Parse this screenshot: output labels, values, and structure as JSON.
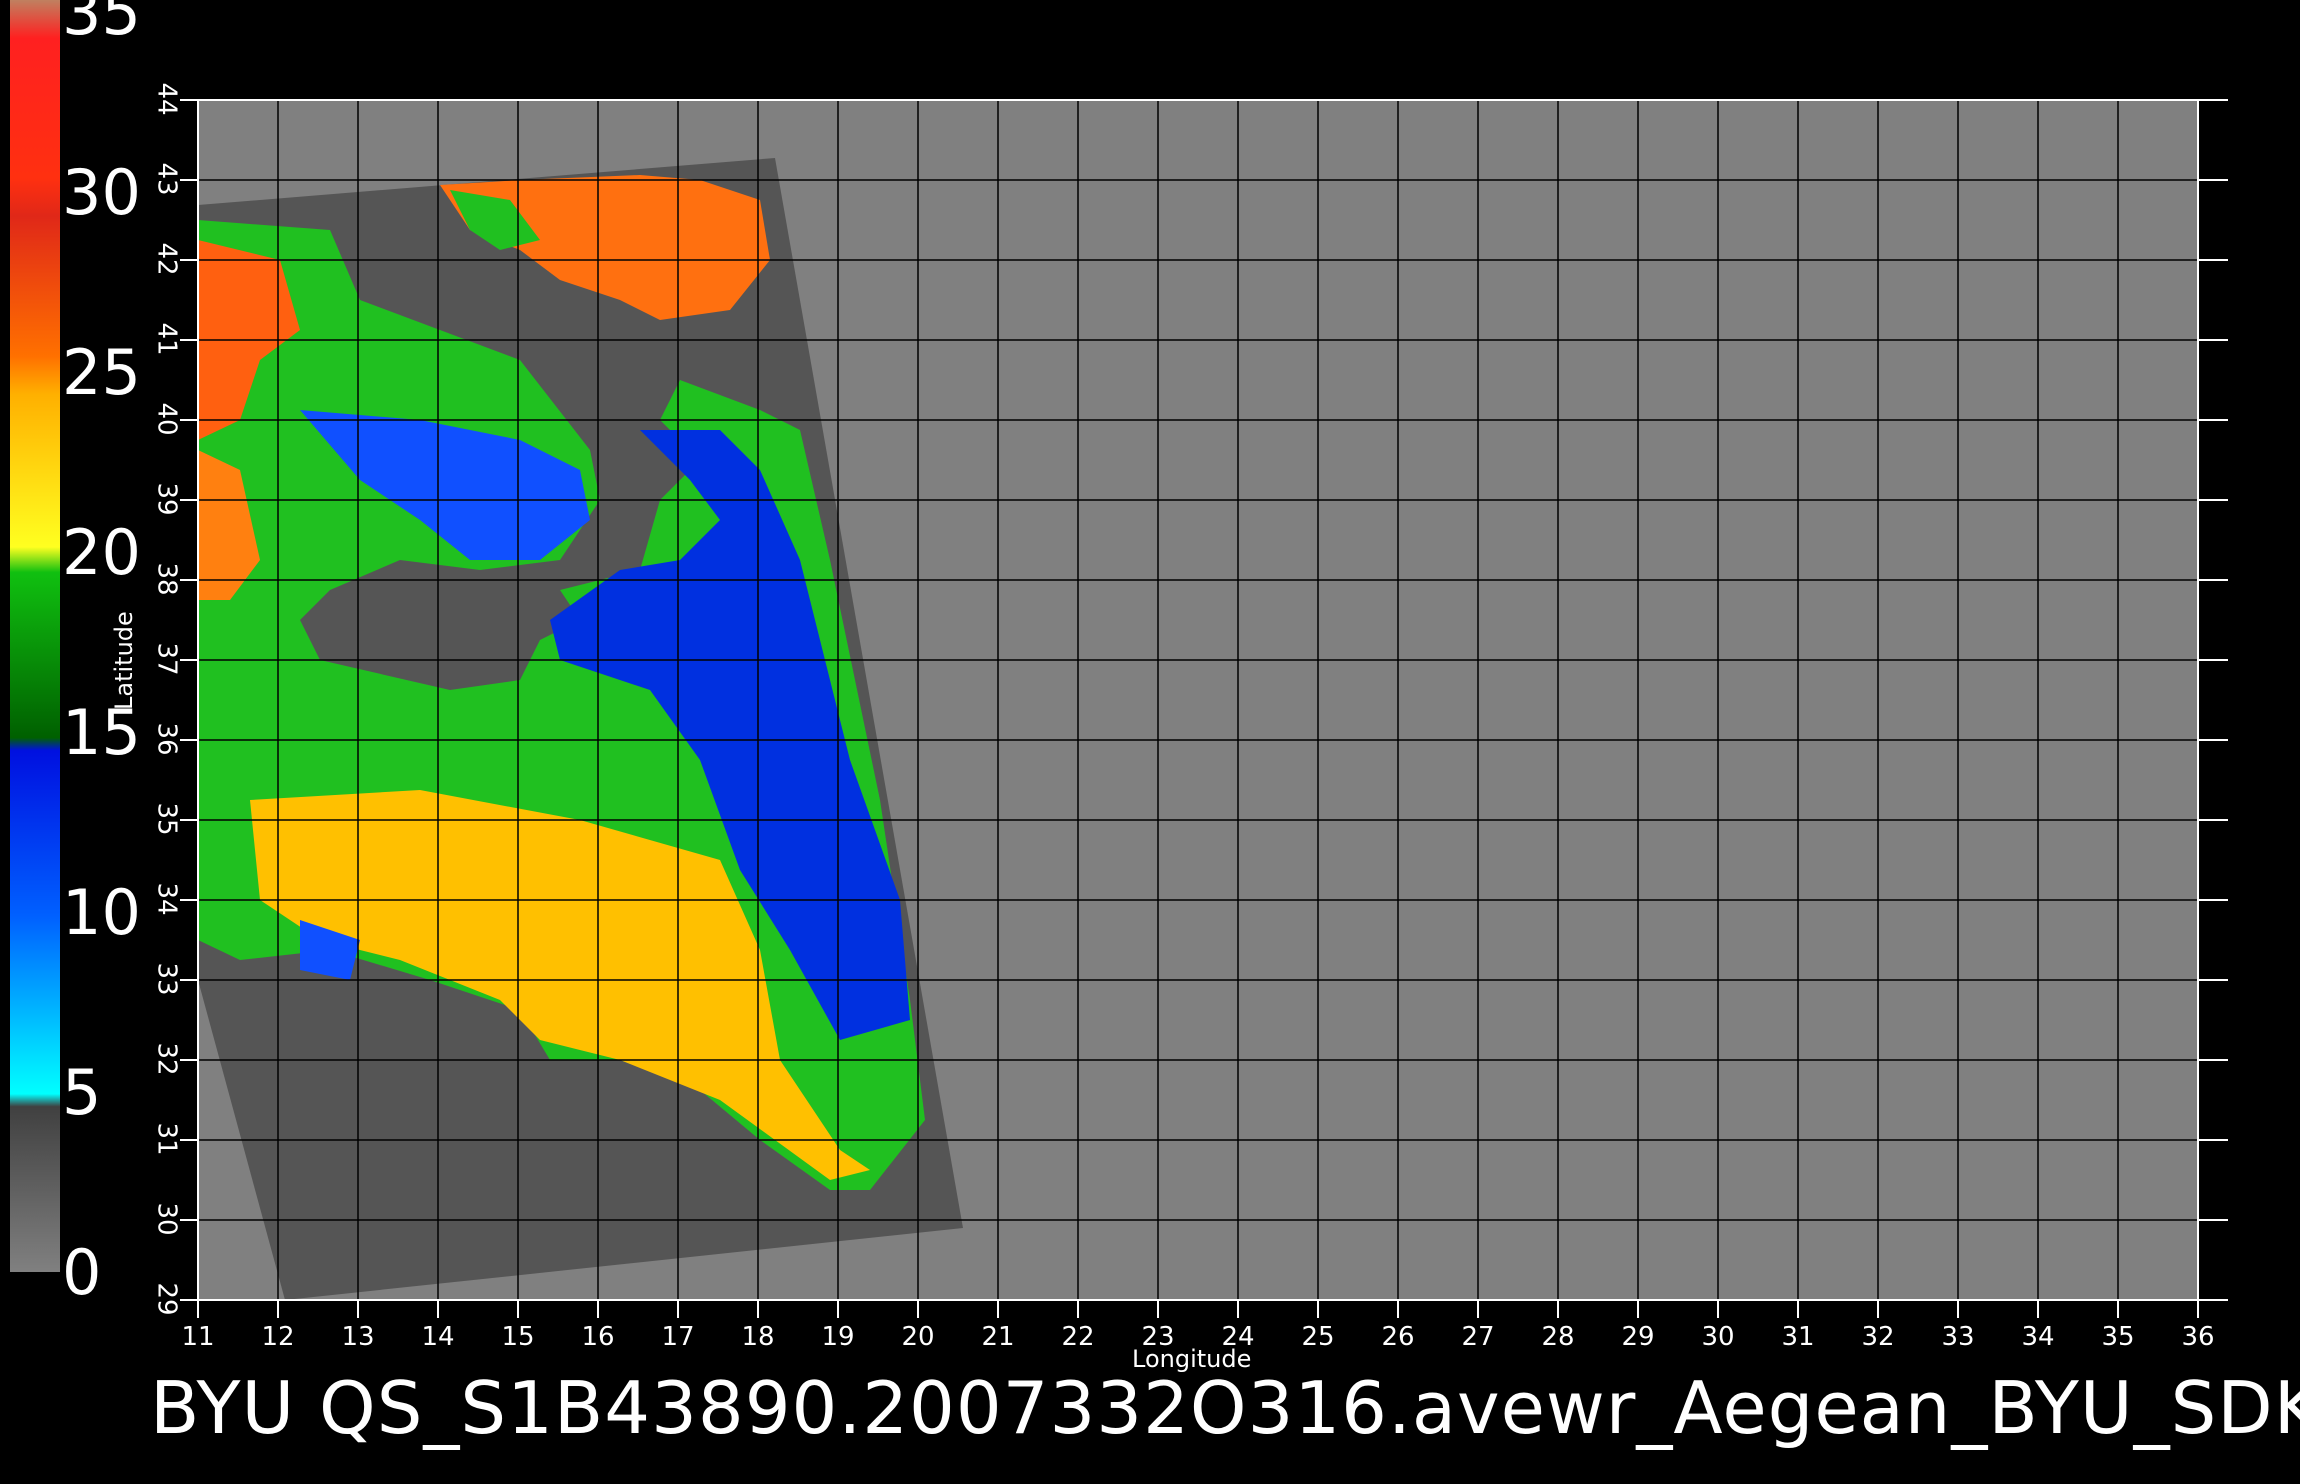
{
  "colorbar": {
    "labels": [
      "35",
      "30",
      "25",
      "20",
      "15",
      "10",
      "5",
      "0"
    ]
  },
  "footer": {
    "title": "BYU  QS_S1B43890.2007332O316.avewr_Aegean_BYU_SDK"
  },
  "axes": {
    "xlabel": "Longitude",
    "ylabel": "Latitude",
    "x_ticks": [
      "11",
      "12",
      "13",
      "14",
      "15",
      "16",
      "17",
      "18",
      "19",
      "20",
      "21",
      "22",
      "23",
      "24",
      "25",
      "26",
      "27",
      "28",
      "29",
      "30",
      "31",
      "32",
      "33",
      "34",
      "35",
      "36"
    ],
    "y_ticks": [
      "29",
      "30",
      "31",
      "32",
      "33",
      "34",
      "35",
      "36",
      "37",
      "38",
      "39",
      "40",
      "41",
      "42",
      "43",
      "44"
    ]
  },
  "colors": {
    "background": "#000000",
    "land": "#808080",
    "swath_nodata": "#555555",
    "grid": "#000000"
  }
}
